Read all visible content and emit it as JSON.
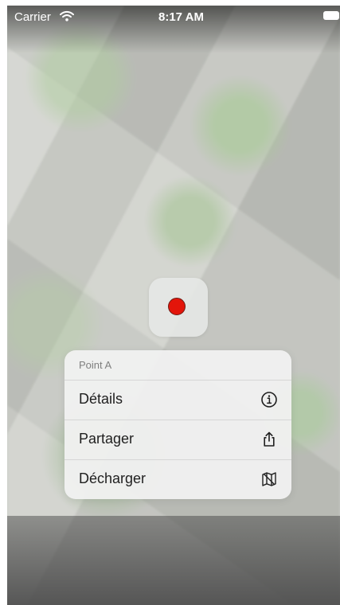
{
  "status_bar": {
    "carrier": "Carrier",
    "time": "8:17 AM",
    "wifi_icon": "wifi-icon",
    "battery_icon": "battery-icon"
  },
  "map": {
    "pin_color": "#e3150a"
  },
  "context_menu": {
    "title": "Point A",
    "items": [
      {
        "label": "Détails",
        "icon": "info-icon"
      },
      {
        "label": "Partager",
        "icon": "share-icon"
      },
      {
        "label": "Décharger",
        "icon": "unloaded-map-icon"
      }
    ]
  }
}
